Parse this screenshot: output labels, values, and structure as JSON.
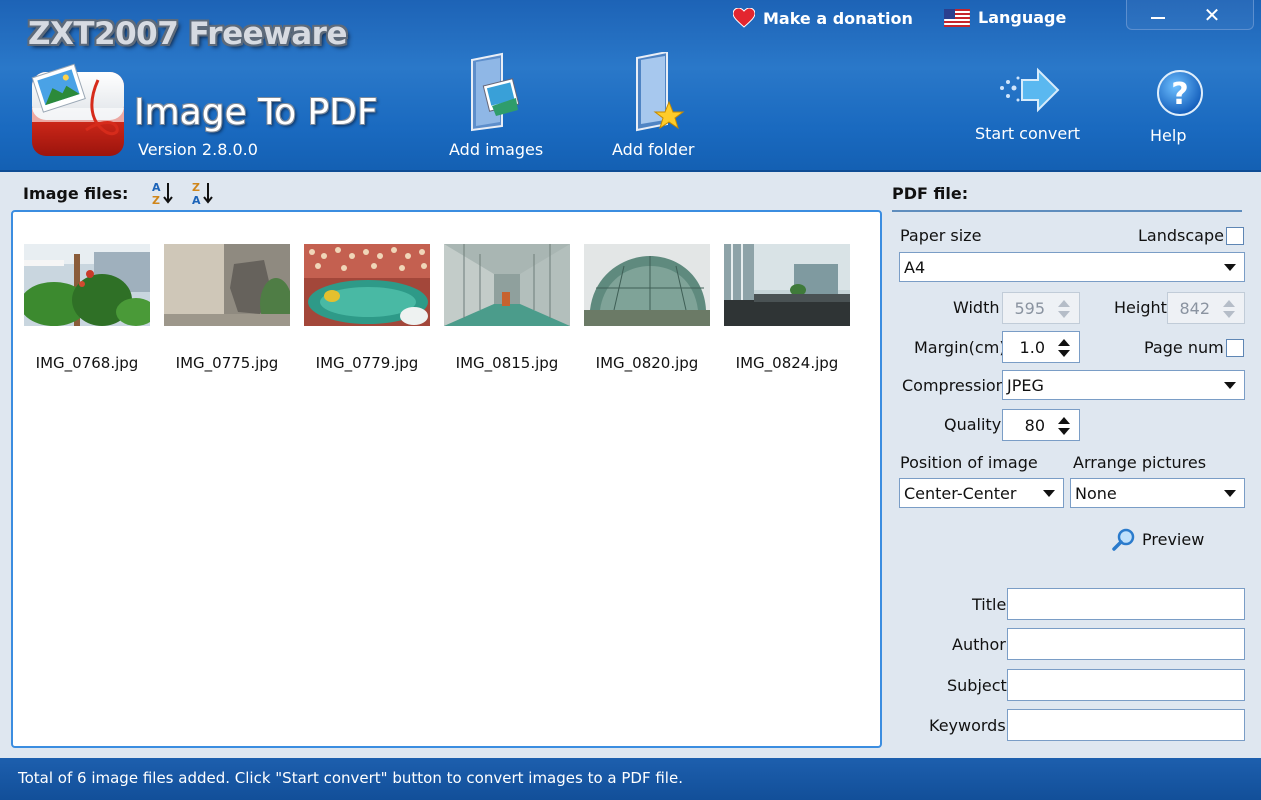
{
  "header": {
    "brand": "ZXT2007 Freeware",
    "app_title": "Image To PDF",
    "version": "Version 2.8.0.0",
    "donation": "Make a donation",
    "language": "Language",
    "tools": {
      "add_images": "Add images",
      "add_folder": "Add folder",
      "start_convert": "Start convert",
      "help": "Help"
    }
  },
  "left": {
    "label": "Image files:",
    "files": [
      {
        "name": "IMG_0768.jpg"
      },
      {
        "name": "IMG_0775.jpg"
      },
      {
        "name": "IMG_0779.jpg"
      },
      {
        "name": "IMG_0815.jpg"
      },
      {
        "name": "IMG_0820.jpg"
      },
      {
        "name": "IMG_0824.jpg"
      }
    ]
  },
  "pdf": {
    "label": "PDF file:",
    "paper_size_label": "Paper size",
    "landscape_label": "Landscape",
    "paper_size": "A4",
    "width_label": "Width",
    "width": "595",
    "height_label": "Height",
    "height": "842",
    "margin_label": "Margin(cm)",
    "margin": "1.0",
    "page_num_label": "Page num",
    "compression_label": "Compression",
    "compression": "JPEG",
    "quality_label": "Quality",
    "quality": "80",
    "position_label": "Position of image",
    "position": "Center-Center",
    "arrange_label": "Arrange pictures",
    "arrange": "None",
    "preview": "Preview",
    "title_label": "Title",
    "author_label": "Author",
    "subject_label": "Subject",
    "keywords_label": "Keywords"
  },
  "status": "Total of 6 image files added. Click \"Start convert\" button to convert images to a PDF file."
}
